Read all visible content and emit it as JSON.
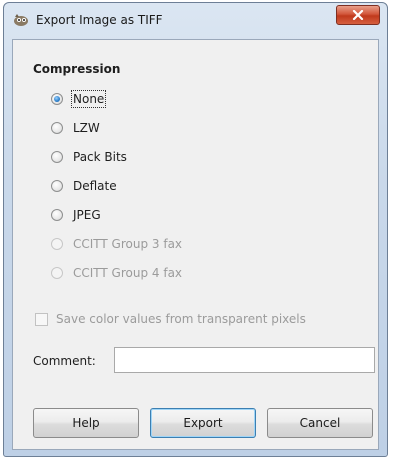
{
  "window": {
    "title": "Export Image as TIFF",
    "close_glyph": "✕"
  },
  "compression": {
    "heading": "Compression",
    "options": [
      {
        "label": "None",
        "checked": true,
        "disabled": false
      },
      {
        "label": "LZW",
        "checked": false,
        "disabled": false
      },
      {
        "label": "Pack Bits",
        "checked": false,
        "disabled": false
      },
      {
        "label": "Deflate",
        "checked": false,
        "disabled": false
      },
      {
        "label": "JPEG",
        "checked": false,
        "disabled": false
      },
      {
        "label": "CCITT Group 3 fax",
        "checked": false,
        "disabled": true
      },
      {
        "label": "CCITT Group 4 fax",
        "checked": false,
        "disabled": true
      }
    ]
  },
  "save_color": {
    "label": "Save color values from transparent pixels",
    "checked": false,
    "disabled": true
  },
  "comment": {
    "label": "Comment:",
    "value": ""
  },
  "buttons": {
    "help": "Help",
    "export": "Export",
    "cancel": "Cancel"
  },
  "icons": {
    "app": "gimp-icon",
    "close": "close-icon"
  },
  "colors": {
    "accent": "#2b7ec9",
    "close_button": "#c0391c"
  }
}
